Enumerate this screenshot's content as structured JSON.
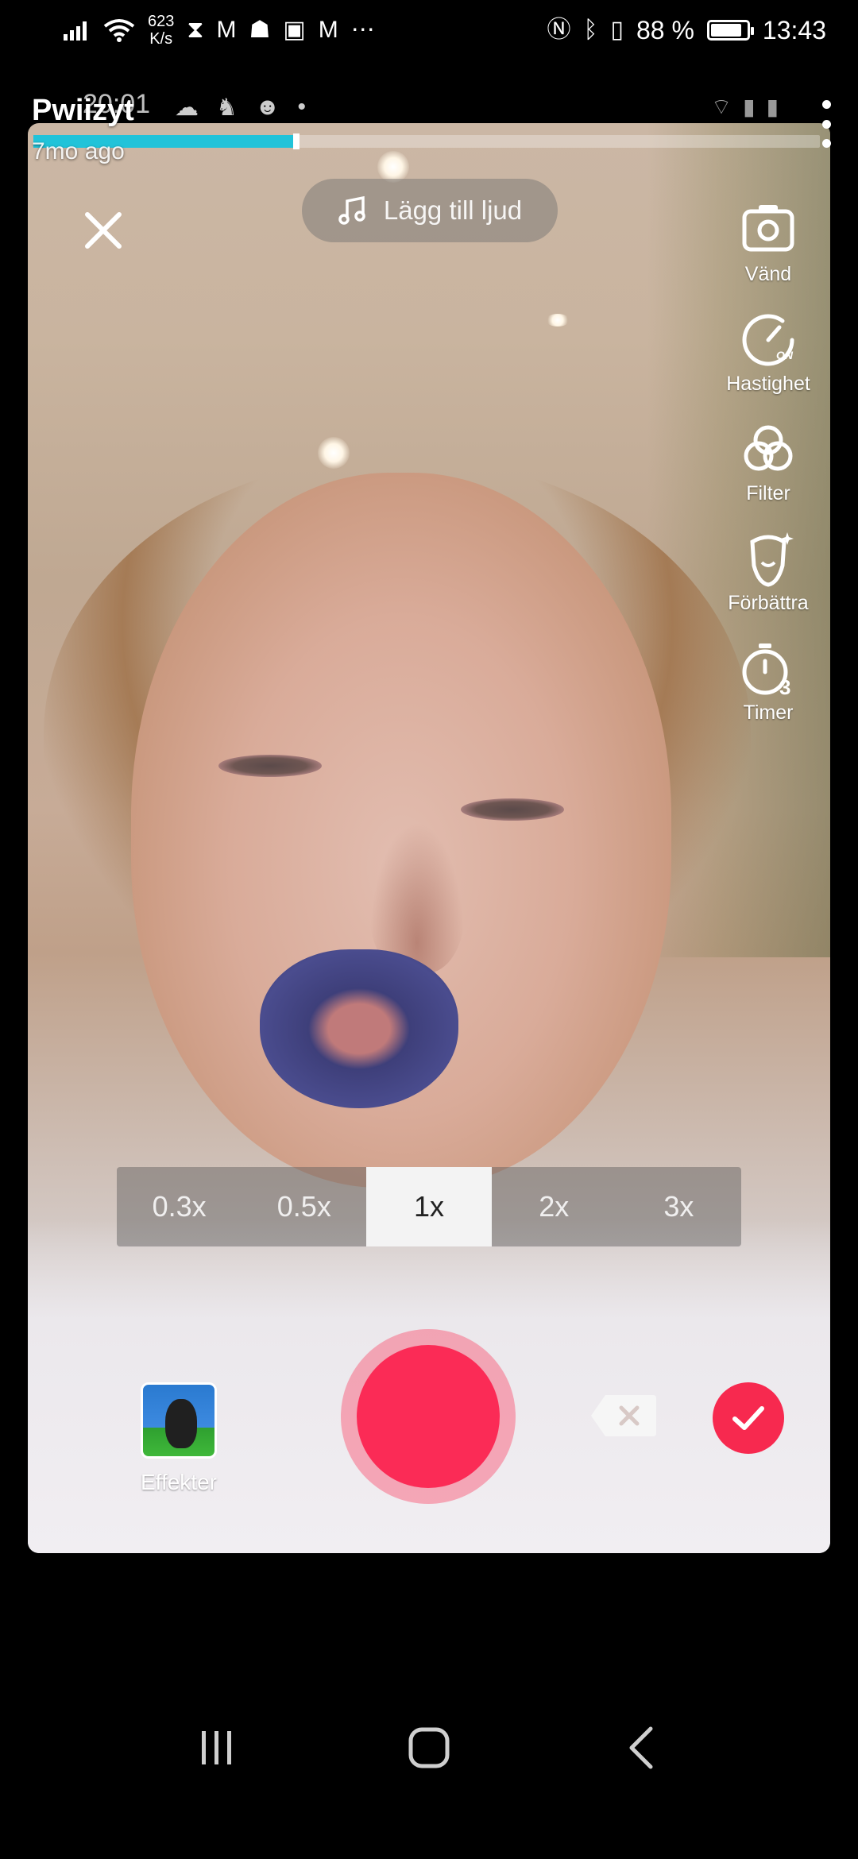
{
  "status_bar": {
    "net_speed_value": "623",
    "net_speed_unit": "K/s",
    "battery": "88 %",
    "battery_level": 0.88,
    "time": "13:43"
  },
  "story": {
    "username": "Pwiizyt",
    "age": "7mo ago",
    "inner_time": "20:01",
    "progress": 0.33,
    "progress_color": "#21c3d9"
  },
  "camera": {
    "add_sound": "Lägg till ljud",
    "tools": [
      {
        "label": "Vänd",
        "icon": "flip-camera-icon"
      },
      {
        "label": "Hastighet",
        "icon": "speed-icon",
        "badge": "ON"
      },
      {
        "label": "Filter",
        "icon": "filter-icon"
      },
      {
        "label": "Förbättra",
        "icon": "beautify-icon"
      },
      {
        "label": "Timer",
        "icon": "timer-icon",
        "badge": "3"
      }
    ],
    "zoom_options": [
      "0.3x",
      "0.5x",
      "1x",
      "2x",
      "3x"
    ],
    "zoom_selected": "1x",
    "effects_label": "Effekter",
    "record_color": "#fb2b56"
  }
}
